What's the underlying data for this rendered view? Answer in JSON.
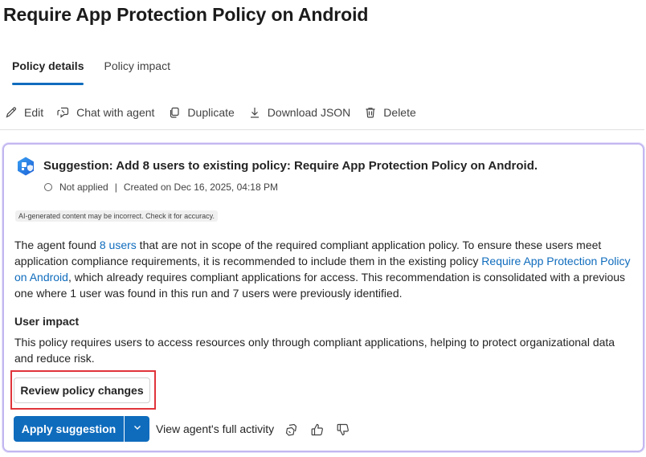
{
  "page": {
    "title": "Require App Protection Policy on Android"
  },
  "tabs": [
    {
      "label": "Policy details",
      "active": true
    },
    {
      "label": "Policy impact",
      "active": false
    }
  ],
  "toolbar": {
    "edit": "Edit",
    "chat": "Chat with agent",
    "duplicate": "Duplicate",
    "download": "Download JSON",
    "delete": "Delete"
  },
  "suggestion": {
    "title": "Suggestion: Add 8 users to existing policy: Require App Protection Policy on Android.",
    "status": "Not applied",
    "created": "Created on Dec 16, 2025, 04:18 PM",
    "ai_notice": "AI-generated content may be incorrect. Check it for accuracy.",
    "body_part1": "The agent found ",
    "body_link1": "8 users",
    "body_part2": " that are not in scope of the required compliant application policy. To ensure these users meet application compliance requirements, it is recommended to include them in the existing policy ",
    "body_link2": "Require App Protection Policy on Android",
    "body_part3": ", which already requires compliant applications for access. This recommendation is consolidated with a previous one where 1 user was found in this run and 7 users were previously identified.",
    "user_impact_heading": "User impact",
    "user_impact_text": "This policy requires users to access resources only through compliant applications, helping to protect organizational data and reduce risk.",
    "review_button": "Review policy changes",
    "apply_button": "Apply suggestion",
    "view_activity": "View agent's full activity"
  },
  "colors": {
    "accent": "#0f6cbd",
    "card_border": "#c3b7f0",
    "highlight": "#e0343a"
  },
  "icons": {
    "edit": "pencil-icon",
    "chat": "agent-chat-icon",
    "duplicate": "copy-icon",
    "download": "download-icon",
    "delete": "trash-icon",
    "suggestion": "shield-app-icon",
    "copy_feedback": "copy-icon",
    "like": "thumbs-up-icon",
    "dislike": "thumbs-down-icon"
  }
}
